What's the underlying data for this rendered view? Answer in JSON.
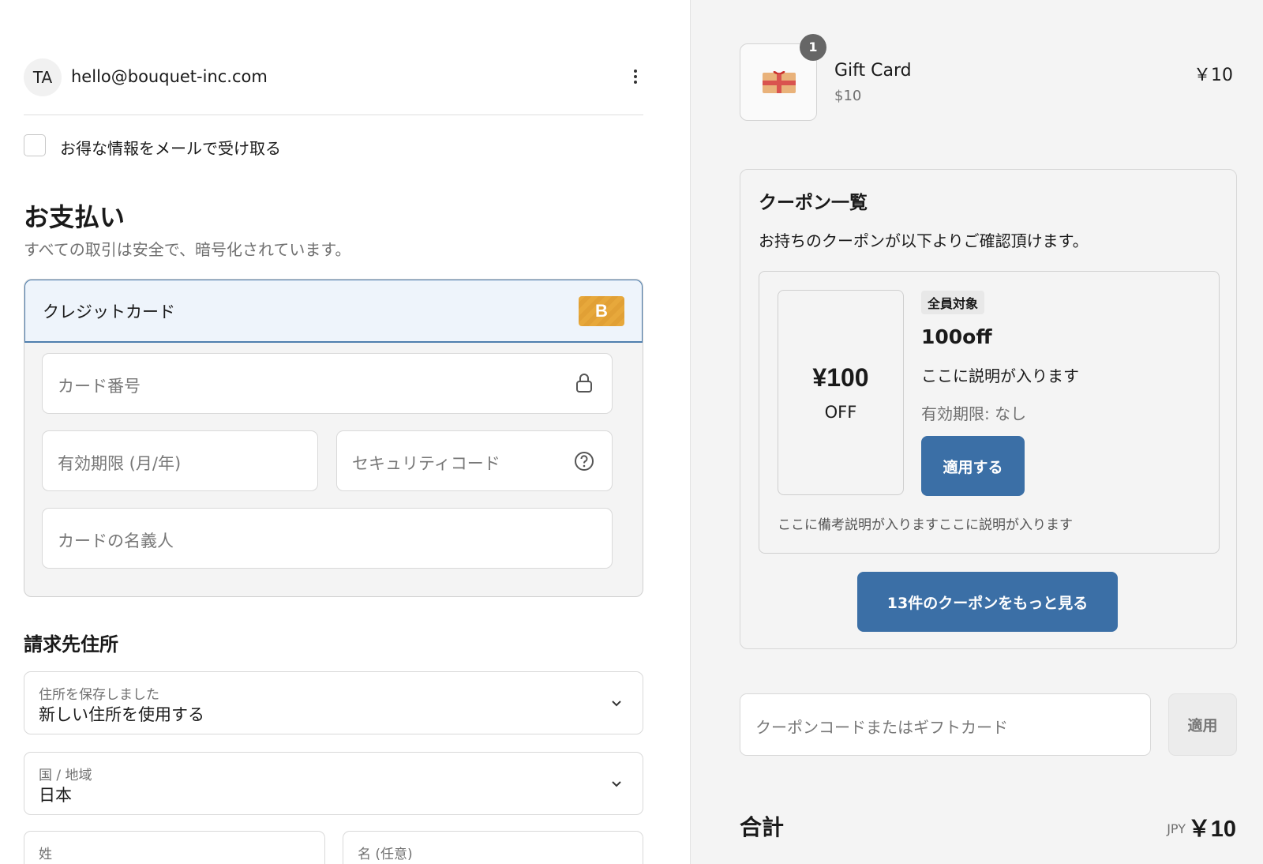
{
  "account": {
    "initials": "TA",
    "email": "hello@bouquet-inc.com",
    "menu_icon": "more-vertical-icon"
  },
  "newsletter": {
    "label": "お得な情報をメールで受け取る",
    "checked": false
  },
  "payment": {
    "title": "お支払い",
    "subtitle": "すべての取引は安全で、暗号化されています。",
    "method_label": "クレジットカード",
    "brand_badge": "B",
    "brand_color": "#e7a83b",
    "selected_border_color": "#4f7fae",
    "card_number_placeholder": "カード番号",
    "expiry_placeholder": "有効期限 (月/年)",
    "cvc_placeholder": "セキュリティコード",
    "name_placeholder": "カードの名義人"
  },
  "billing": {
    "title": "請求先住所",
    "saved_address_label": "住所を保存しました",
    "saved_address_value": "新しい住所を使用する",
    "country_label": "国 / 地域",
    "country_value": "日本",
    "last_name_label": "姓",
    "first_name_label": "名 (任意)"
  },
  "order": {
    "item": {
      "name": "Gift Card",
      "variant": "$10",
      "price": "￥10",
      "quantity": "1"
    },
    "coupons": {
      "title": "クーポン一覧",
      "description": "お持ちのクーポンが以下よりご確認頂けます。",
      "card": {
        "amount": "¥100",
        "off": "OFF",
        "tag": "全員対象",
        "name": "100off",
        "text": "ここに説明が入ります",
        "expiry": "有効期限: なし",
        "apply_label": "適用する",
        "note": "ここに備考説明が入りますここに説明が入ります"
      },
      "more_label": "13件のクーポンをもっと見る"
    },
    "code_placeholder": "クーポンコードまたはギフトカード",
    "code_apply_label": "適用",
    "total_label": "合計",
    "total_currency": "JPY",
    "total_amount": "￥10",
    "accent_color": "#3b6fa6"
  }
}
